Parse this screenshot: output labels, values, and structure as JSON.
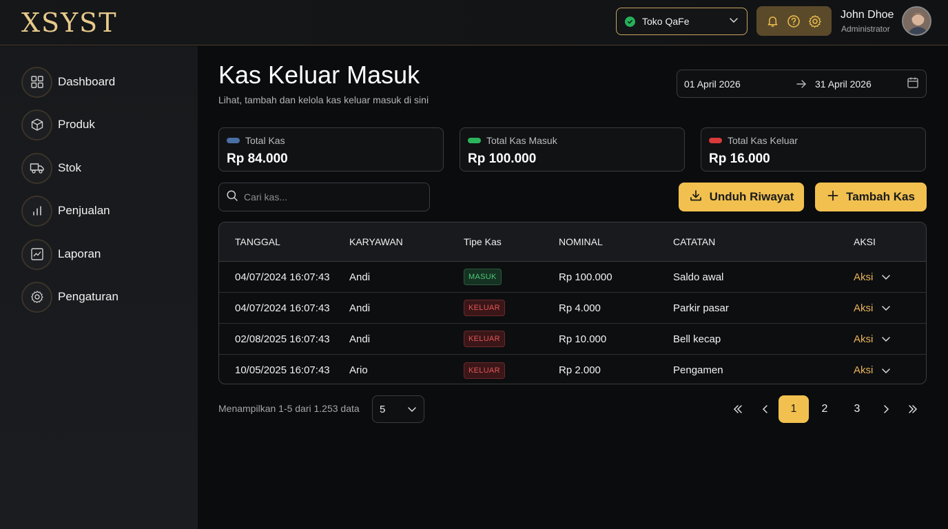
{
  "app": {
    "logo": "XSYST"
  },
  "header": {
    "store": {
      "name": "Toko QaFe"
    },
    "user": {
      "name": "John Dhoe",
      "role": "Administrator"
    }
  },
  "sidebar": {
    "items": [
      {
        "label": "Dashboard",
        "icon": "grid-icon"
      },
      {
        "label": "Produk",
        "icon": "box-icon"
      },
      {
        "label": "Stok",
        "icon": "truck-icon"
      },
      {
        "label": "Penjualan",
        "icon": "bar-chart-icon"
      },
      {
        "label": "Laporan",
        "icon": "line-chart-icon"
      },
      {
        "label": "Pengaturan",
        "icon": "gear-icon"
      }
    ]
  },
  "page": {
    "title": "Kas Keluar Masuk",
    "subtitle": "Lihat, tambah dan kelola kas keluar masuk di sini"
  },
  "date_range": {
    "from": "01 April 2026",
    "to": "31 April 2026"
  },
  "stats": [
    {
      "label": "Total Kas",
      "value": "Rp 84.000",
      "color": "#4a6fa5"
    },
    {
      "label": "Total Kas Masuk",
      "value": "Rp 100.000",
      "color": "#2bb45c"
    },
    {
      "label": "Total Kas Keluar",
      "value": "Rp 16.000",
      "color": "#d93a3a"
    }
  ],
  "search": {
    "placeholder": "Cari kas..."
  },
  "actions": {
    "download_label": "Unduh Riwayat",
    "add_label": "Tambah Kas"
  },
  "table": {
    "columns": [
      "TANGGAL",
      "KARYAWAN",
      "Tipe Kas",
      "NOMINAL",
      "CATATAN",
      "AKSI"
    ],
    "rows": [
      {
        "tanggal": "04/07/2024 16:07:43",
        "karyawan": "Andi",
        "tipe": "MASUK",
        "nominal": "Rp 100.000",
        "catatan": "Saldo awal",
        "aksi": "Aksi"
      },
      {
        "tanggal": "04/07/2024 16:07:43",
        "karyawan": "Andi",
        "tipe": "KELUAR",
        "nominal": "Rp 4.000",
        "catatan": "Parkir pasar",
        "aksi": "Aksi"
      },
      {
        "tanggal": "02/08/2025 16:07:43",
        "karyawan": "Andi",
        "tipe": "KELUAR",
        "nominal": "Rp 10.000",
        "catatan": "Bell kecap",
        "aksi": "Aksi"
      },
      {
        "tanggal": "10/05/2025 16:07:43",
        "karyawan": "Ario",
        "tipe": "KELUAR",
        "nominal": "Rp 2.000",
        "catatan": "Pengamen",
        "aksi": "Aksi"
      }
    ]
  },
  "footer": {
    "showing": "Menampilkan 1-5 dari 1.253 data",
    "per_page": "5",
    "pages": [
      "1",
      "2",
      "3"
    ],
    "current_page": "1"
  },
  "colors": {
    "accent": "#f1c04f",
    "gold": "#e7c98a"
  }
}
